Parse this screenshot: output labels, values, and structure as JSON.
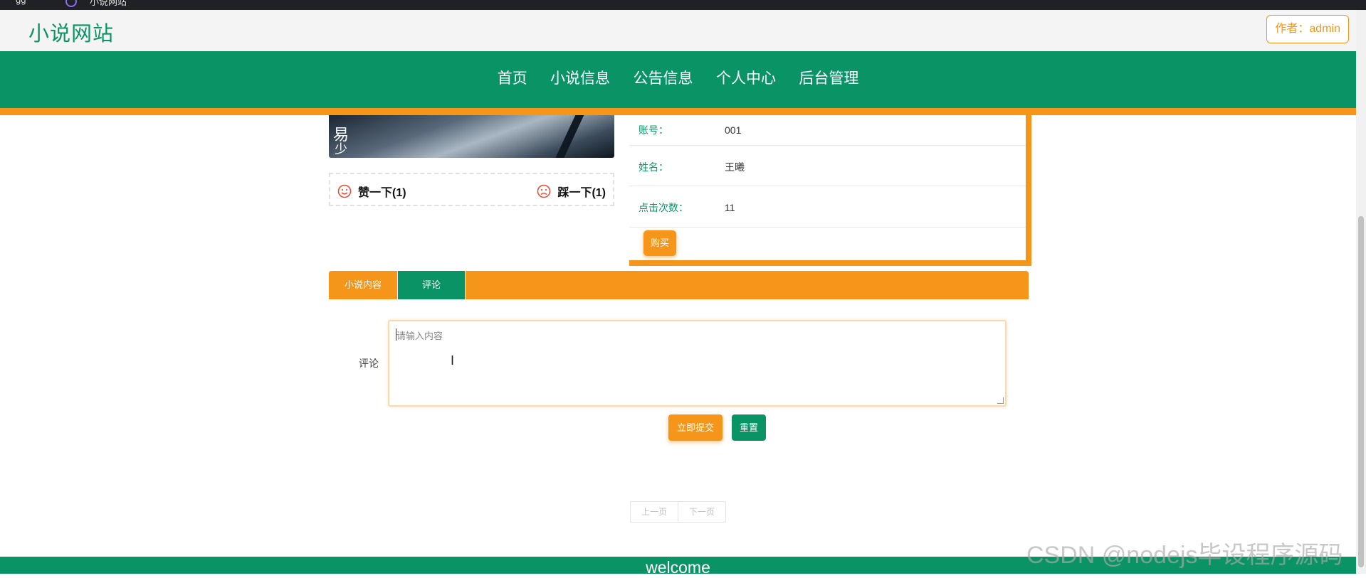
{
  "browser": {
    "tab_left": "gg",
    "tab_title": "小说网站"
  },
  "header": {
    "site_title": "小说网站",
    "author_label": "作者：admin"
  },
  "nav": {
    "items": [
      "首页",
      "小说信息",
      "公告信息",
      "个人中心",
      "后台管理"
    ]
  },
  "cover": {
    "visible_glyphs": [
      "易",
      "少"
    ]
  },
  "votes": {
    "like": "赞一下(1)",
    "dislike": "踩一下(1)"
  },
  "info": {
    "rows": [
      {
        "label": "账号：",
        "value": "001"
      },
      {
        "label": "姓名：",
        "value": "王曦"
      },
      {
        "label": "点击次数：",
        "value": "11"
      }
    ],
    "buy_label": "购买"
  },
  "tabs": {
    "items": [
      "小说内容",
      "评论"
    ],
    "active": "评论"
  },
  "comment_form": {
    "label": "评论",
    "placeholder": "请输入内容",
    "value": "",
    "submit_label": "立即提交",
    "reset_label": "重置"
  },
  "pager": {
    "prev": "上一页",
    "next": "下一页"
  },
  "footer": {
    "welcome": "welcome"
  },
  "watermark": "CSDN @nodejs毕设程序源码",
  "colors": {
    "primary": "#0a9466",
    "accent": "#f5951a",
    "header_bg": "#f4f4f5"
  },
  "icons": {
    "like": "smile-face-icon",
    "dislike": "frown-face-icon"
  }
}
